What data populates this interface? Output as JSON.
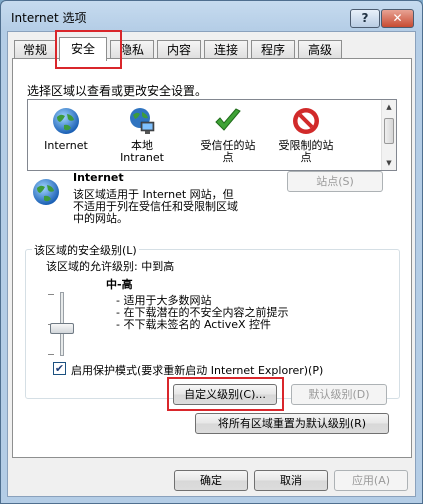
{
  "window": {
    "title": "Internet 选项",
    "help_label": "?",
    "close_label": "✕"
  },
  "tabs": [
    {
      "label": "常规"
    },
    {
      "label": "安全"
    },
    {
      "label": "隐私"
    },
    {
      "label": "内容"
    },
    {
      "label": "连接"
    },
    {
      "label": "程序"
    },
    {
      "label": "高级"
    }
  ],
  "security": {
    "zone_prompt": "选择区域以查看或更改安全设置。",
    "zones": [
      {
        "label": "Internet",
        "icon": "globe-icon"
      },
      {
        "label": "本地\nIntranet",
        "icon": "intranet-icon"
      },
      {
        "label": "受信任的站\n点",
        "icon": "check-icon"
      },
      {
        "label": "受限制的站\n点",
        "icon": "no-entry-icon"
      }
    ],
    "selected_zone": {
      "name": "Internet",
      "description": "该区域适用于 Internet 网站，但\n不适用于列在受信任和受限制区域\n中的网站。",
      "sites_button": "站点(S)"
    },
    "level_group": {
      "title": "该区域的安全级别(L)",
      "allowed_levels": "该区域的允许级别: 中到高",
      "level_name": "中-高",
      "bullets": [
        "- 适用于大多数网站",
        "- 在下载潜在的不安全内容之前提示",
        "- 不下载未签名的 ActiveX 控件"
      ],
      "slider_level": 0.5,
      "protected_mode_label": "启用保护模式(要求重新启动 Internet Explorer)(P)",
      "protected_mode_checked": "✔",
      "custom_level_button": "自定义级别(C)...",
      "default_level_button": "默认级别(D)"
    },
    "reset_all_button": "将所有区域重置为默认级别(R)"
  },
  "footer": {
    "ok": "确定",
    "cancel": "取消",
    "apply": "应用(A)"
  },
  "colors": {
    "highlight": "#d9262b",
    "title_gradient": "#c6dbef"
  }
}
